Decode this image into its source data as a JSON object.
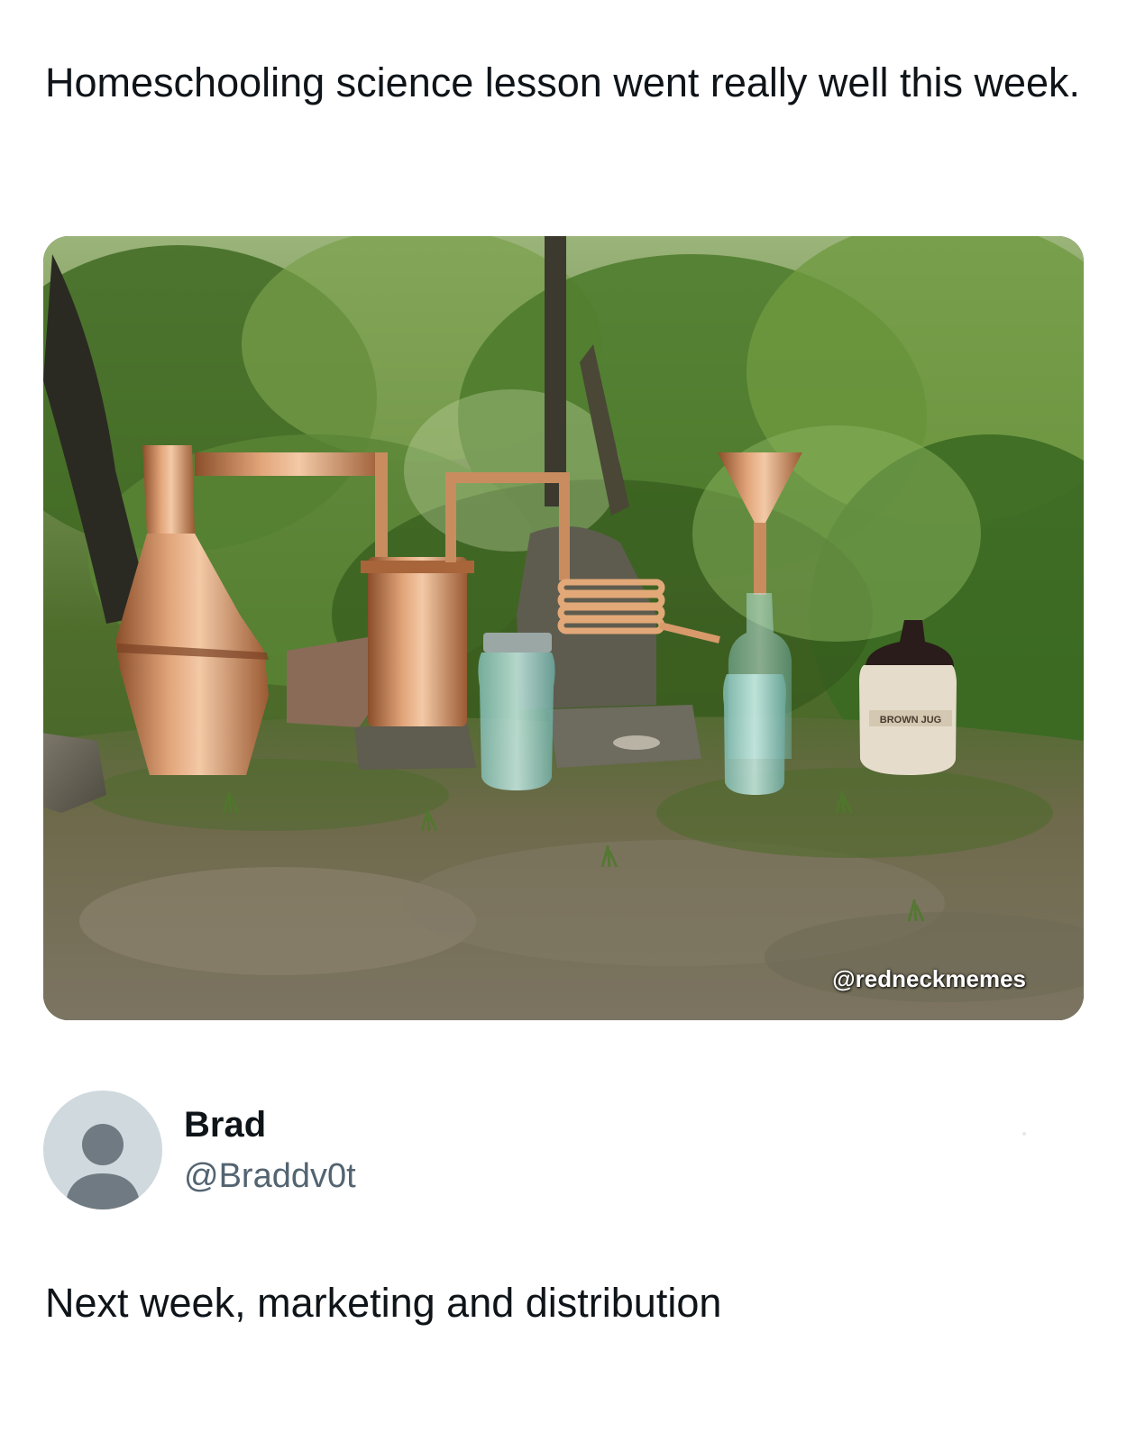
{
  "post": {
    "text": "Homeschooling science lesson went really well this week.",
    "image": {
      "alt_subject": "copper still in the woods",
      "watermark": "@redneckmemes",
      "jug_label": "BROWN JUG"
    }
  },
  "reply": {
    "author": {
      "display_name": "Brad",
      "handle": "@Braddv0t",
      "avatar_icon": "default-avatar-icon"
    },
    "text": "Next week, marketing and distribution"
  },
  "colors": {
    "text_primary": "#0f1419",
    "text_secondary": "#536471",
    "avatar_bg": "#cfd9de",
    "avatar_fg": "#6f7a82",
    "copper": "#c9885a"
  }
}
